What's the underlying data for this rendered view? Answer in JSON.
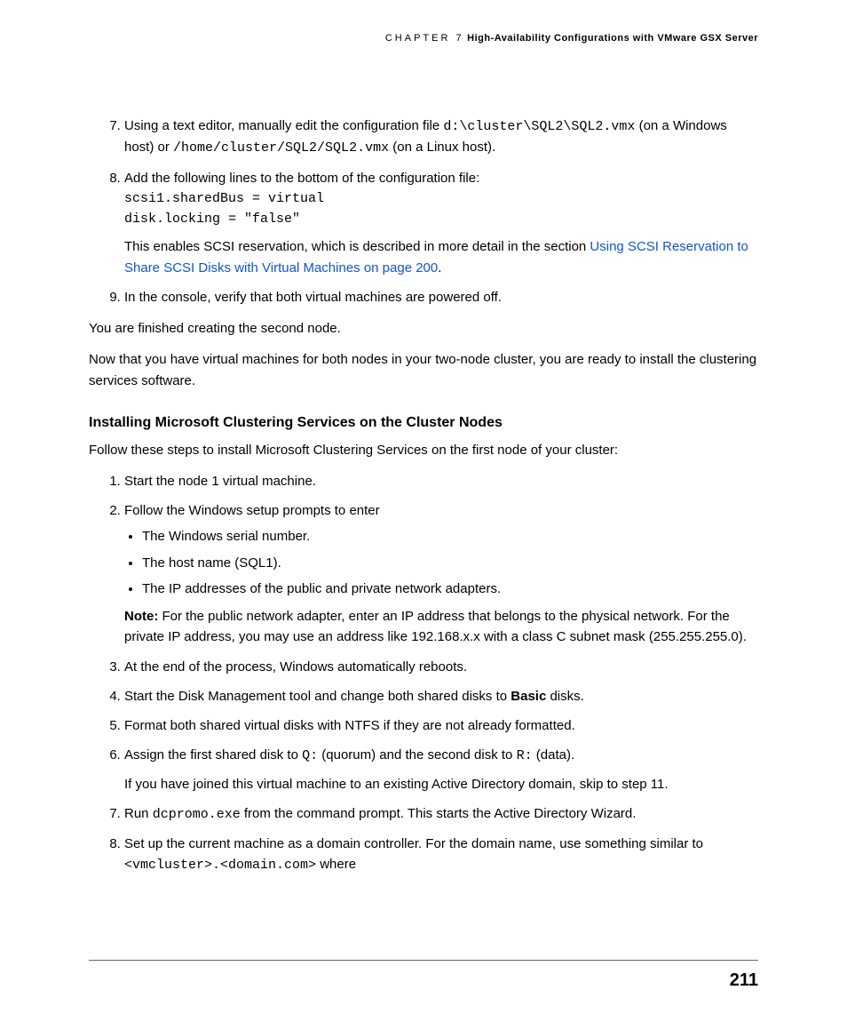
{
  "header": {
    "chapter": "CHAPTER 7",
    "title": "High-Availability Configurations with VMware GSX Server"
  },
  "list1": {
    "item7_a": "Using a text editor, manually edit the configuration file ",
    "item7_code1": "d:\\cluster\\SQL2\\SQL2.vmx",
    "item7_b": " (on a Windows host) or ",
    "item7_code2": "/home/cluster/SQL2/SQL2.vmx",
    "item7_c": " (on a Linux host).",
    "item8_a": "Add the following lines to the bottom of the configuration file:",
    "item8_code1": "scsi1.sharedBus = virtual",
    "item8_code2": "disk.locking = \"false\"",
    "item8_b": "This enables SCSI reservation, which is described in more detail in the section ",
    "item8_link": "Using SCSI Reservation to Share SCSI Disks with Virtual Machines on page 200",
    "item8_c": ".",
    "item9": "In the console, verify that both virtual machines are powered off."
  },
  "para1": "You are finished creating the second node.",
  "para2": "Now that you have virtual machines for both nodes in your two-node cluster, you are ready to install the clustering services software.",
  "heading": "Installing Microsoft Clustering Services on the Cluster Nodes",
  "para3": "Follow these steps to install Microsoft Clustering Services on the first node of your cluster:",
  "list2": {
    "item1": "Start the node 1 virtual machine.",
    "item2": "Follow the Windows setup prompts to enter",
    "item2_b1": "The Windows serial number.",
    "item2_b2": "The host name (SQL1).",
    "item2_b3": "The IP addresses of the public and private network adapters.",
    "item2_note_label": "Note:",
    "item2_note": "  For the public network adapter, enter an IP address that belongs to the physical network. For the private IP address, you may use an address like 192.168.x.x with a class C subnet mask (255.255.255.0).",
    "item3": "At the end of the process, Windows automatically reboots.",
    "item4_a": "Start the Disk Management tool and change both shared disks to ",
    "item4_b": "Basic",
    "item4_c": " disks.",
    "item5": "Format both shared virtual disks with NTFS if they are not already formatted.",
    "item6_a": "Assign the first shared disk to ",
    "item6_code1": "Q:",
    "item6_b": " (quorum) and the second disk to ",
    "item6_code2": "R:",
    "item6_c": " (data).",
    "item6_p": "If you have joined this virtual machine to an existing Active Directory domain, skip to step 11.",
    "item7_a": "Run ",
    "item7_code": "dcpromo.exe",
    "item7_b": " from the command prompt. This starts the Active Directory Wizard.",
    "item8_a": "Set up the current machine as a domain controller. For the domain name, use something similar to ",
    "item8_code": "<vmcluster>.<domain.com>",
    "item8_b": " where"
  },
  "pagenum": "211"
}
